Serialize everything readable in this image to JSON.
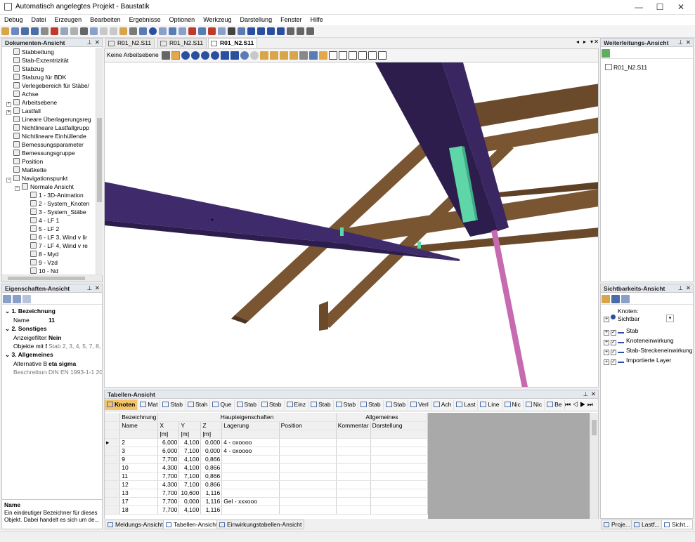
{
  "window": {
    "title": "Automatisch angelegtes Projekt - Baustatik",
    "minimize": "—",
    "maximize": "☐",
    "close": "✕"
  },
  "menu": [
    "Debug",
    "Datei",
    "Erzeugen",
    "Bearbeiten",
    "Ergebnisse",
    "Optionen",
    "Werkzeug",
    "Darstellung",
    "Fenster",
    "Hilfe"
  ],
  "documents": {
    "title": "Dokumenten-Ansicht",
    "items": [
      {
        "label": "Stabbettung",
        "indent": 0,
        "icon": "bedding-icon"
      },
      {
        "label": "Stab-Exzentrizität",
        "indent": 0,
        "icon": "eccentricity-icon"
      },
      {
        "label": "Stabzug",
        "indent": 0,
        "icon": "polyline-icon"
      },
      {
        "label": "Stabzug für BDK",
        "indent": 0,
        "icon": "polyline-icon"
      },
      {
        "label": "Verlegebereich für Stäbe/",
        "indent": 0,
        "icon": "area-icon"
      },
      {
        "label": "Achse",
        "indent": 0,
        "icon": "axis-icon"
      },
      {
        "label": "Arbeitsebene",
        "indent": 0,
        "icon": "plane-icon",
        "expander": "+"
      },
      {
        "label": "Lastfall",
        "indent": 0,
        "icon": "loadcase-icon",
        "expander": "+"
      },
      {
        "label": "Lineare Überlagerungsreg",
        "indent": 0,
        "icon": "superposition-icon"
      },
      {
        "label": "Nichtlineare Lastfallgrupp",
        "indent": 0,
        "icon": "nonlinear-icon"
      },
      {
        "label": "Nichtlineare Einhüllende",
        "indent": 0,
        "icon": "nonlinear-icon"
      },
      {
        "label": "Bemessungsparameter",
        "indent": 0,
        "icon": "parameter-icon"
      },
      {
        "label": "Bemessungsgruppe",
        "indent": 0,
        "icon": "group-icon"
      },
      {
        "label": "Position",
        "indent": 0,
        "icon": "position-icon"
      },
      {
        "label": "Maßkette",
        "indent": 0,
        "icon": "dimension-icon"
      },
      {
        "label": "Navigationspunkt",
        "indent": 0,
        "icon": "navpoint-icon",
        "expander": "−"
      },
      {
        "label": "Normale Ansicht",
        "indent": 1,
        "icon": "view-icon",
        "expander": "−"
      },
      {
        "label": "1 - 3D-Animation",
        "indent": 2,
        "icon": "camera-icon"
      },
      {
        "label": "2 - System_Knoten",
        "indent": 2,
        "icon": "camera-icon"
      },
      {
        "label": "3 - System_Stäbe",
        "indent": 2,
        "icon": "camera-icon"
      },
      {
        "label": "4 - LF 1",
        "indent": 2,
        "icon": "camera-icon"
      },
      {
        "label": "5 - LF 2",
        "indent": 2,
        "icon": "camera-icon"
      },
      {
        "label": "6 - LF 3, Wind v lir",
        "indent": 2,
        "icon": "camera-icon"
      },
      {
        "label": "7 - LF 4, Wind v re",
        "indent": 2,
        "icon": "camera-icon"
      },
      {
        "label": "8 - Myd",
        "indent": 2,
        "icon": "camera-icon"
      },
      {
        "label": "9 - Vzd",
        "indent": 2,
        "icon": "camera-icon"
      },
      {
        "label": "10 - Nd",
        "indent": 2,
        "icon": "camera-icon"
      }
    ]
  },
  "properties": {
    "title": "Eigenschaften-Ansicht",
    "sections": [
      {
        "header": "1. Bezeichnung",
        "rows": [
          {
            "key": "Name",
            "value": "11"
          }
        ]
      },
      {
        "header": "2. Sonstiges",
        "rows": [
          {
            "key": "Anzeigefilter:",
            "value": "Nein"
          },
          {
            "key": "Objekte mit E",
            "value": "Stab 2, 3, 4, 5, 7, 8, 9,"
          }
        ]
      },
      {
        "header": "3. Allgemeines",
        "rows": [
          {
            "key": "Alternative B",
            "value": "eta sigma"
          },
          {
            "key": "Beschreibung",
            "value": "DIN EN 1993-1-1 2010"
          }
        ]
      }
    ],
    "help_title": "Name",
    "help_text": "Ein eindeutiger Bezeichner für dieses Objekt. Dabei handelt es sich um de..."
  },
  "viewport": {
    "tabs": [
      {
        "label": "R01_N2.S11",
        "active": false
      },
      {
        "label": "R01_N2.S11",
        "active": false
      },
      {
        "label": "R01_N2.S11",
        "active": true
      }
    ],
    "layer_select": "Keine Arbeitsebene",
    "colors": {
      "background": "#ffffff",
      "girder": "#7a5532",
      "beam": "#3f2a6b",
      "stiffener": "#5fd6a8",
      "brace": "#c66ab2"
    }
  },
  "table": {
    "title": "Tabellen-Ansicht",
    "tabs": [
      "Knoten",
      "Mat",
      "Stab",
      "Stah",
      "Que",
      "Stab",
      "Stab",
      "Einz",
      "Stab",
      "Stab",
      "Stab",
      "Stab",
      "Verl",
      "Ach",
      "Last",
      "Line",
      "Nic",
      "Nic",
      "Be"
    ],
    "group_headers": {
      "bez": "Bezeichnung",
      "haupt": "Haupteigenschaften",
      "allg": "Allgemeines"
    },
    "columns": [
      "Name",
      "X",
      "Y",
      "Z",
      "Lagerung",
      "Position",
      "Kommentar",
      "Darstellung"
    ],
    "units": [
      "",
      "[m]",
      "[m]",
      "[m]",
      "",
      "",
      "",
      ""
    ],
    "rows": [
      [
        "2",
        "6,000",
        "4,100",
        "0,000",
        "4 - oxoooo",
        "",
        "",
        ""
      ],
      [
        "3",
        "6,000",
        "7,100",
        "0,000",
        "4 - oxoooo",
        "",
        "",
        ""
      ],
      [
        "9",
        "7,700",
        "4,100",
        "0,866",
        "",
        "",
        "",
        ""
      ],
      [
        "10",
        "4,300",
        "4,100",
        "0,866",
        "",
        "",
        "",
        ""
      ],
      [
        "11",
        "7,700",
        "7,100",
        "0,866",
        "",
        "",
        "",
        ""
      ],
      [
        "12",
        "4,300",
        "7,100",
        "0,866",
        "",
        "",
        "",
        ""
      ],
      [
        "13",
        "7,700",
        "10,600",
        "1,116",
        "",
        "",
        "",
        ""
      ],
      [
        "17",
        "7,700",
        "0,000",
        "1,116",
        "Gel - xxxooo",
        "",
        "",
        ""
      ],
      [
        "18",
        "7,700",
        "4,100",
        "1,116",
        "",
        "",
        "",
        ""
      ]
    ]
  },
  "bottom_tabs": [
    "Meldungs-Ansicht",
    "Tabellen-Ansicht",
    "Einwirkungstabellen-Ansicht"
  ],
  "forwarding": {
    "title": "Weiterleitungs-Ansicht",
    "item": "R01_N2.S11"
  },
  "visibility": {
    "title": "Sichtbarkeits-Ansicht",
    "knoten_label": "Knoten:",
    "knoten_value": "Sichtbar",
    "items": [
      "Stab",
      "Knoteneinwirkung",
      "Stab-Streckeneinwirkung",
      "Importierte Layer"
    ]
  },
  "right_bottom_tabs": [
    "Proje...",
    "Lastf...",
    "Sicht..."
  ]
}
